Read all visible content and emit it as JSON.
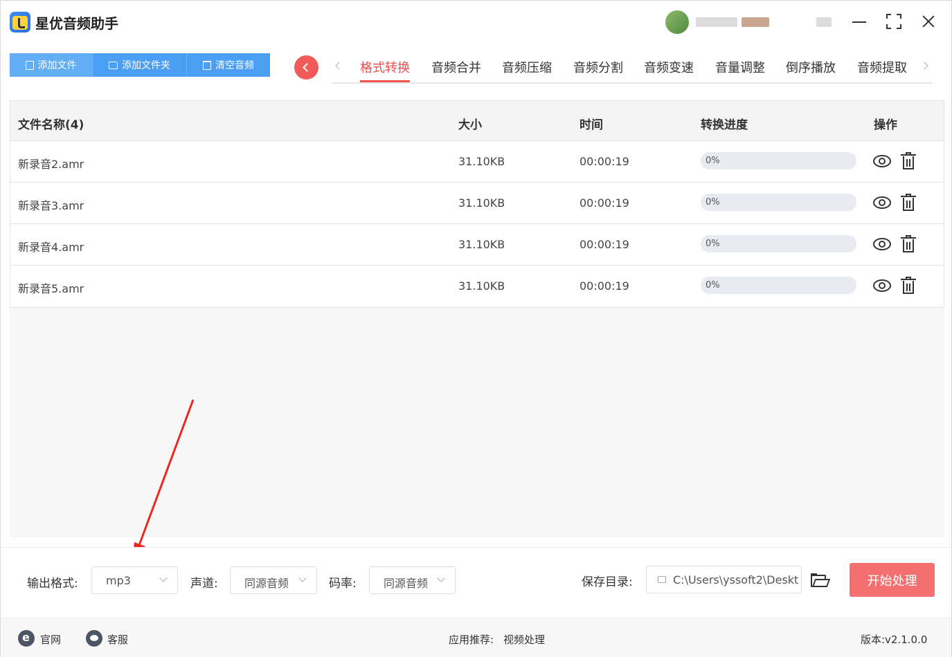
{
  "app": {
    "title": "星优音频助手"
  },
  "toolbar": {
    "add_file": "添加文件",
    "add_folder": "添加文件夹",
    "clear_audio": "清空音频"
  },
  "tabs": [
    {
      "label": "格式转换",
      "active": true
    },
    {
      "label": "音频合并",
      "active": false
    },
    {
      "label": "音频压缩",
      "active": false
    },
    {
      "label": "音频分割",
      "active": false
    },
    {
      "label": "音频变速",
      "active": false
    },
    {
      "label": "音量调整",
      "active": false
    },
    {
      "label": "倒序播放",
      "active": false
    },
    {
      "label": "音频提取",
      "active": false
    }
  ],
  "table": {
    "headers": {
      "name": "文件名称(4)",
      "size": "大小",
      "time": "时间",
      "progress": "转换进度",
      "action": "操作"
    },
    "rows": [
      {
        "name": "新录音2.amr",
        "size": "31.10KB",
        "time": "00:00:19",
        "progress": "0%",
        "progress_value": 0
      },
      {
        "name": "新录音3.amr",
        "size": "31.10KB",
        "time": "00:00:19",
        "progress": "0%",
        "progress_value": 0
      },
      {
        "name": "新录音4.amr",
        "size": "31.10KB",
        "time": "00:00:19",
        "progress": "0%",
        "progress_value": 0
      },
      {
        "name": "新录音5.amr",
        "size": "31.10KB",
        "time": "00:00:19",
        "progress": "0%",
        "progress_value": 0
      }
    ]
  },
  "settings": {
    "output_format_label": "输出格式:",
    "output_format_value": "mp3",
    "channel_label": "声道:",
    "channel_value": "同源音频",
    "bitrate_label": "码率:",
    "bitrate_value": "同源音频",
    "save_dir_label": "保存目录:",
    "save_dir_value": "C:\\Users\\yssoft2\\Deskt",
    "start_button": "开始处理"
  },
  "footer": {
    "website": "官网",
    "support": "客服",
    "recommend_label": "应用推荐:",
    "recommend_value": "视频处理",
    "version": "版本:v2.1.0.0"
  },
  "colors": {
    "accent_blue": "#4a9ff5",
    "accent_red": "#f0504f",
    "start_button": "#f47070"
  }
}
